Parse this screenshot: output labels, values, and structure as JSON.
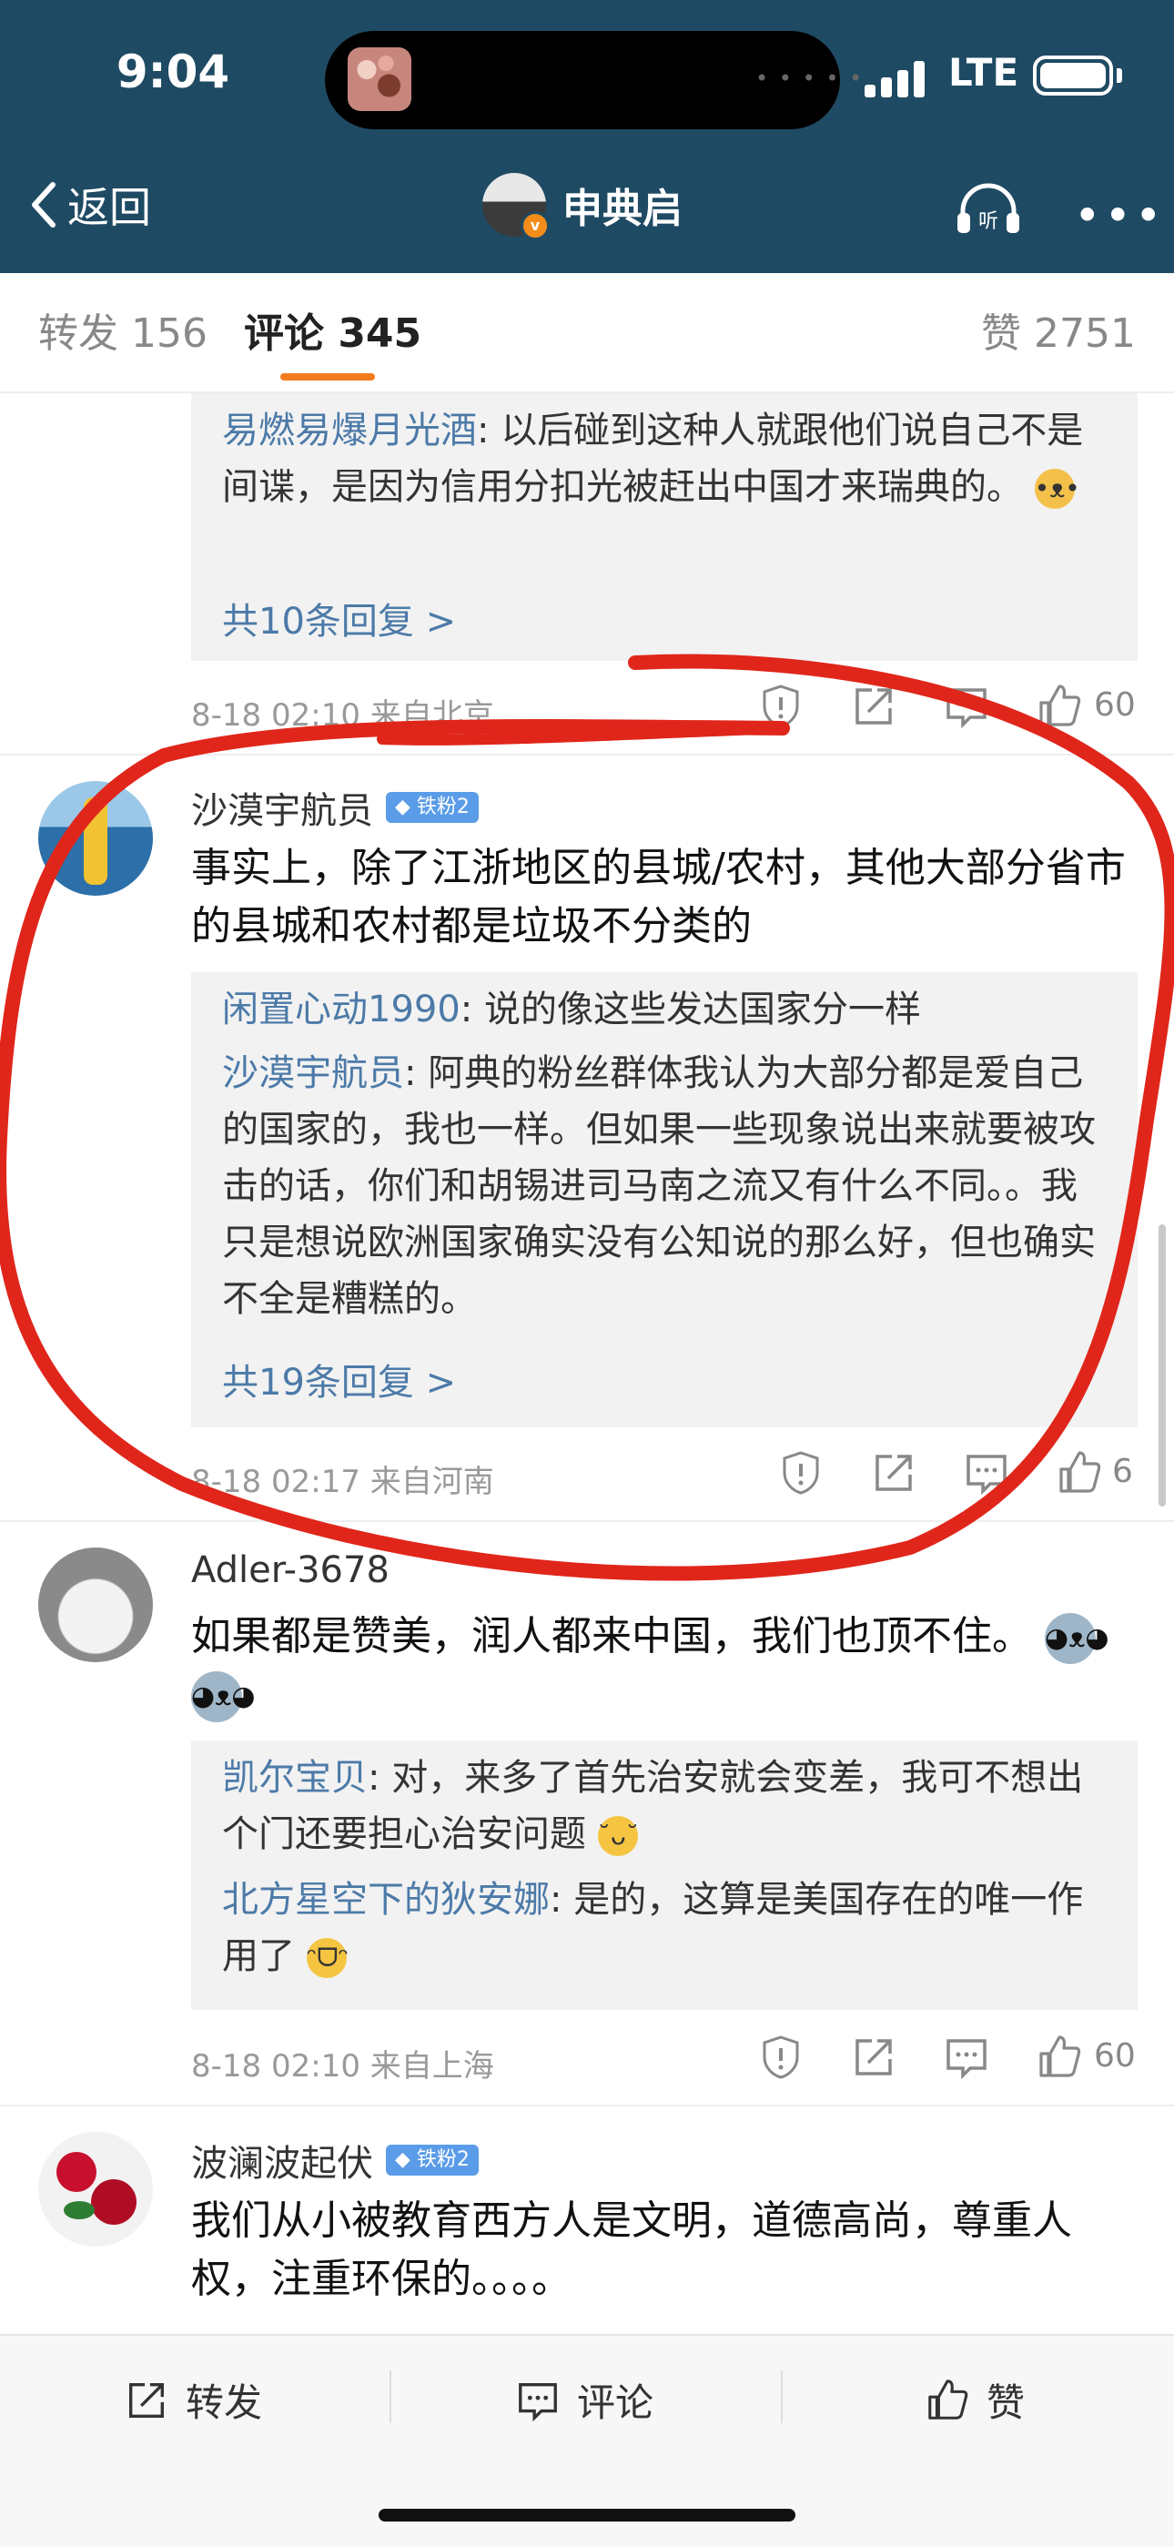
{
  "status_bar": {
    "time": "9:04",
    "network": "LTE"
  },
  "nav": {
    "back_label": "返回",
    "title": "申典启",
    "listen_label": "听"
  },
  "tabs": [
    {
      "label": "转发 156"
    },
    {
      "label": "评论 345"
    },
    {
      "label": "赞 2751"
    }
  ],
  "comments": [
    {
      "replies": [
        {
          "user": "易燃易爆月光酒",
          "text": ": 以后碰到这种人就跟他们说自己不是间谍，是因为信用分扣光被赶出中国才来瑞典的。"
        }
      ],
      "more_replies": "共10条回复 >",
      "meta": "8-18 02:10  来自北京",
      "likes": "60"
    },
    {
      "user": "沙漠宇航员",
      "badge": "铁粉2",
      "text": "事实上，除了江浙地区的县城/农村，其他大部分省市的县城和农村都是垃圾不分类的",
      "replies": [
        {
          "user": "闲置心动1990",
          "text": ": 说的像这些发达国家分一样"
        },
        {
          "user": "沙漠宇航员",
          "text": ": 阿典的粉丝群体我认为大部分都是爱自己的国家的，我也一样。但如果一些现象说出来就要被攻击的话，你们和胡锡进司马南之流又有什么不同。。我只是想说欧洲国家确实没有公知说的那么好，但也确实不全是糟糕的。"
        }
      ],
      "more_replies": "共19条回复 >",
      "meta": "8-18 02:17  来自河南",
      "likes": "6"
    },
    {
      "user": "Adler-3678",
      "text": "如果都是赞美，润人都来中国，我们也顶不住。",
      "replies": [
        {
          "user": "凯尔宝贝",
          "text": ": 对，来多了首先治安就会变差，我可不想出个门还要担心治安问题"
        },
        {
          "user": "北方星空下的狄安娜",
          "text": ": 是的，这算是美国存在的唯一作用了"
        }
      ],
      "meta": "8-18 02:10  来自上海",
      "likes": "60"
    },
    {
      "user": "波澜波起伏",
      "badge": "铁粉2",
      "text": "我们从小被教育西方人是文明，道德高尚，尊重人权，注重环保的。。。。"
    }
  ],
  "bottom_bar": {
    "repost": "转发",
    "comment": "评论",
    "like": "赞"
  },
  "colors": {
    "header": "#1f4a63",
    "accent": "#f47b20",
    "link": "#4c7aa8",
    "annotation": "#e0261b"
  }
}
